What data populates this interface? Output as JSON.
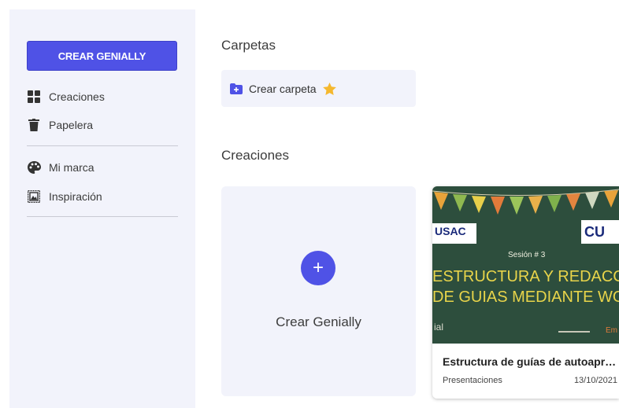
{
  "sidebar": {
    "create_button": "CREAR GENIALLY",
    "items": [
      {
        "label": "Creaciones",
        "icon": "grid-icon"
      },
      {
        "label": "Papelera",
        "icon": "trash-icon"
      },
      {
        "label": "Mi marca",
        "icon": "palette-icon"
      },
      {
        "label": "Inspiración",
        "icon": "frame-icon"
      }
    ]
  },
  "folders": {
    "title": "Carpetas",
    "create_label": "Crear carpeta"
  },
  "creations": {
    "title": "Creaciones",
    "new_label": "Crear Genially",
    "cards": [
      {
        "title": "Estructura de guías de autoapr…",
        "type": "Presentaciones",
        "date": "13/10/2021",
        "thumbnail": {
          "logo_left": "USAC",
          "logo_right": "CU",
          "session": "Sesión # 3",
          "line1": "ESTRUCTURA Y REDACCIÓ",
          "line2": "DE GUIAS MEDIANTE WOR",
          "bottom_left": "ial",
          "bottom_right": "Em"
        }
      }
    ]
  },
  "colors": {
    "accent": "#4f52e6",
    "sidebar_bg": "#f2f3fb",
    "thumb_bg": "#2d4e3d",
    "star": "#f5b82e"
  }
}
